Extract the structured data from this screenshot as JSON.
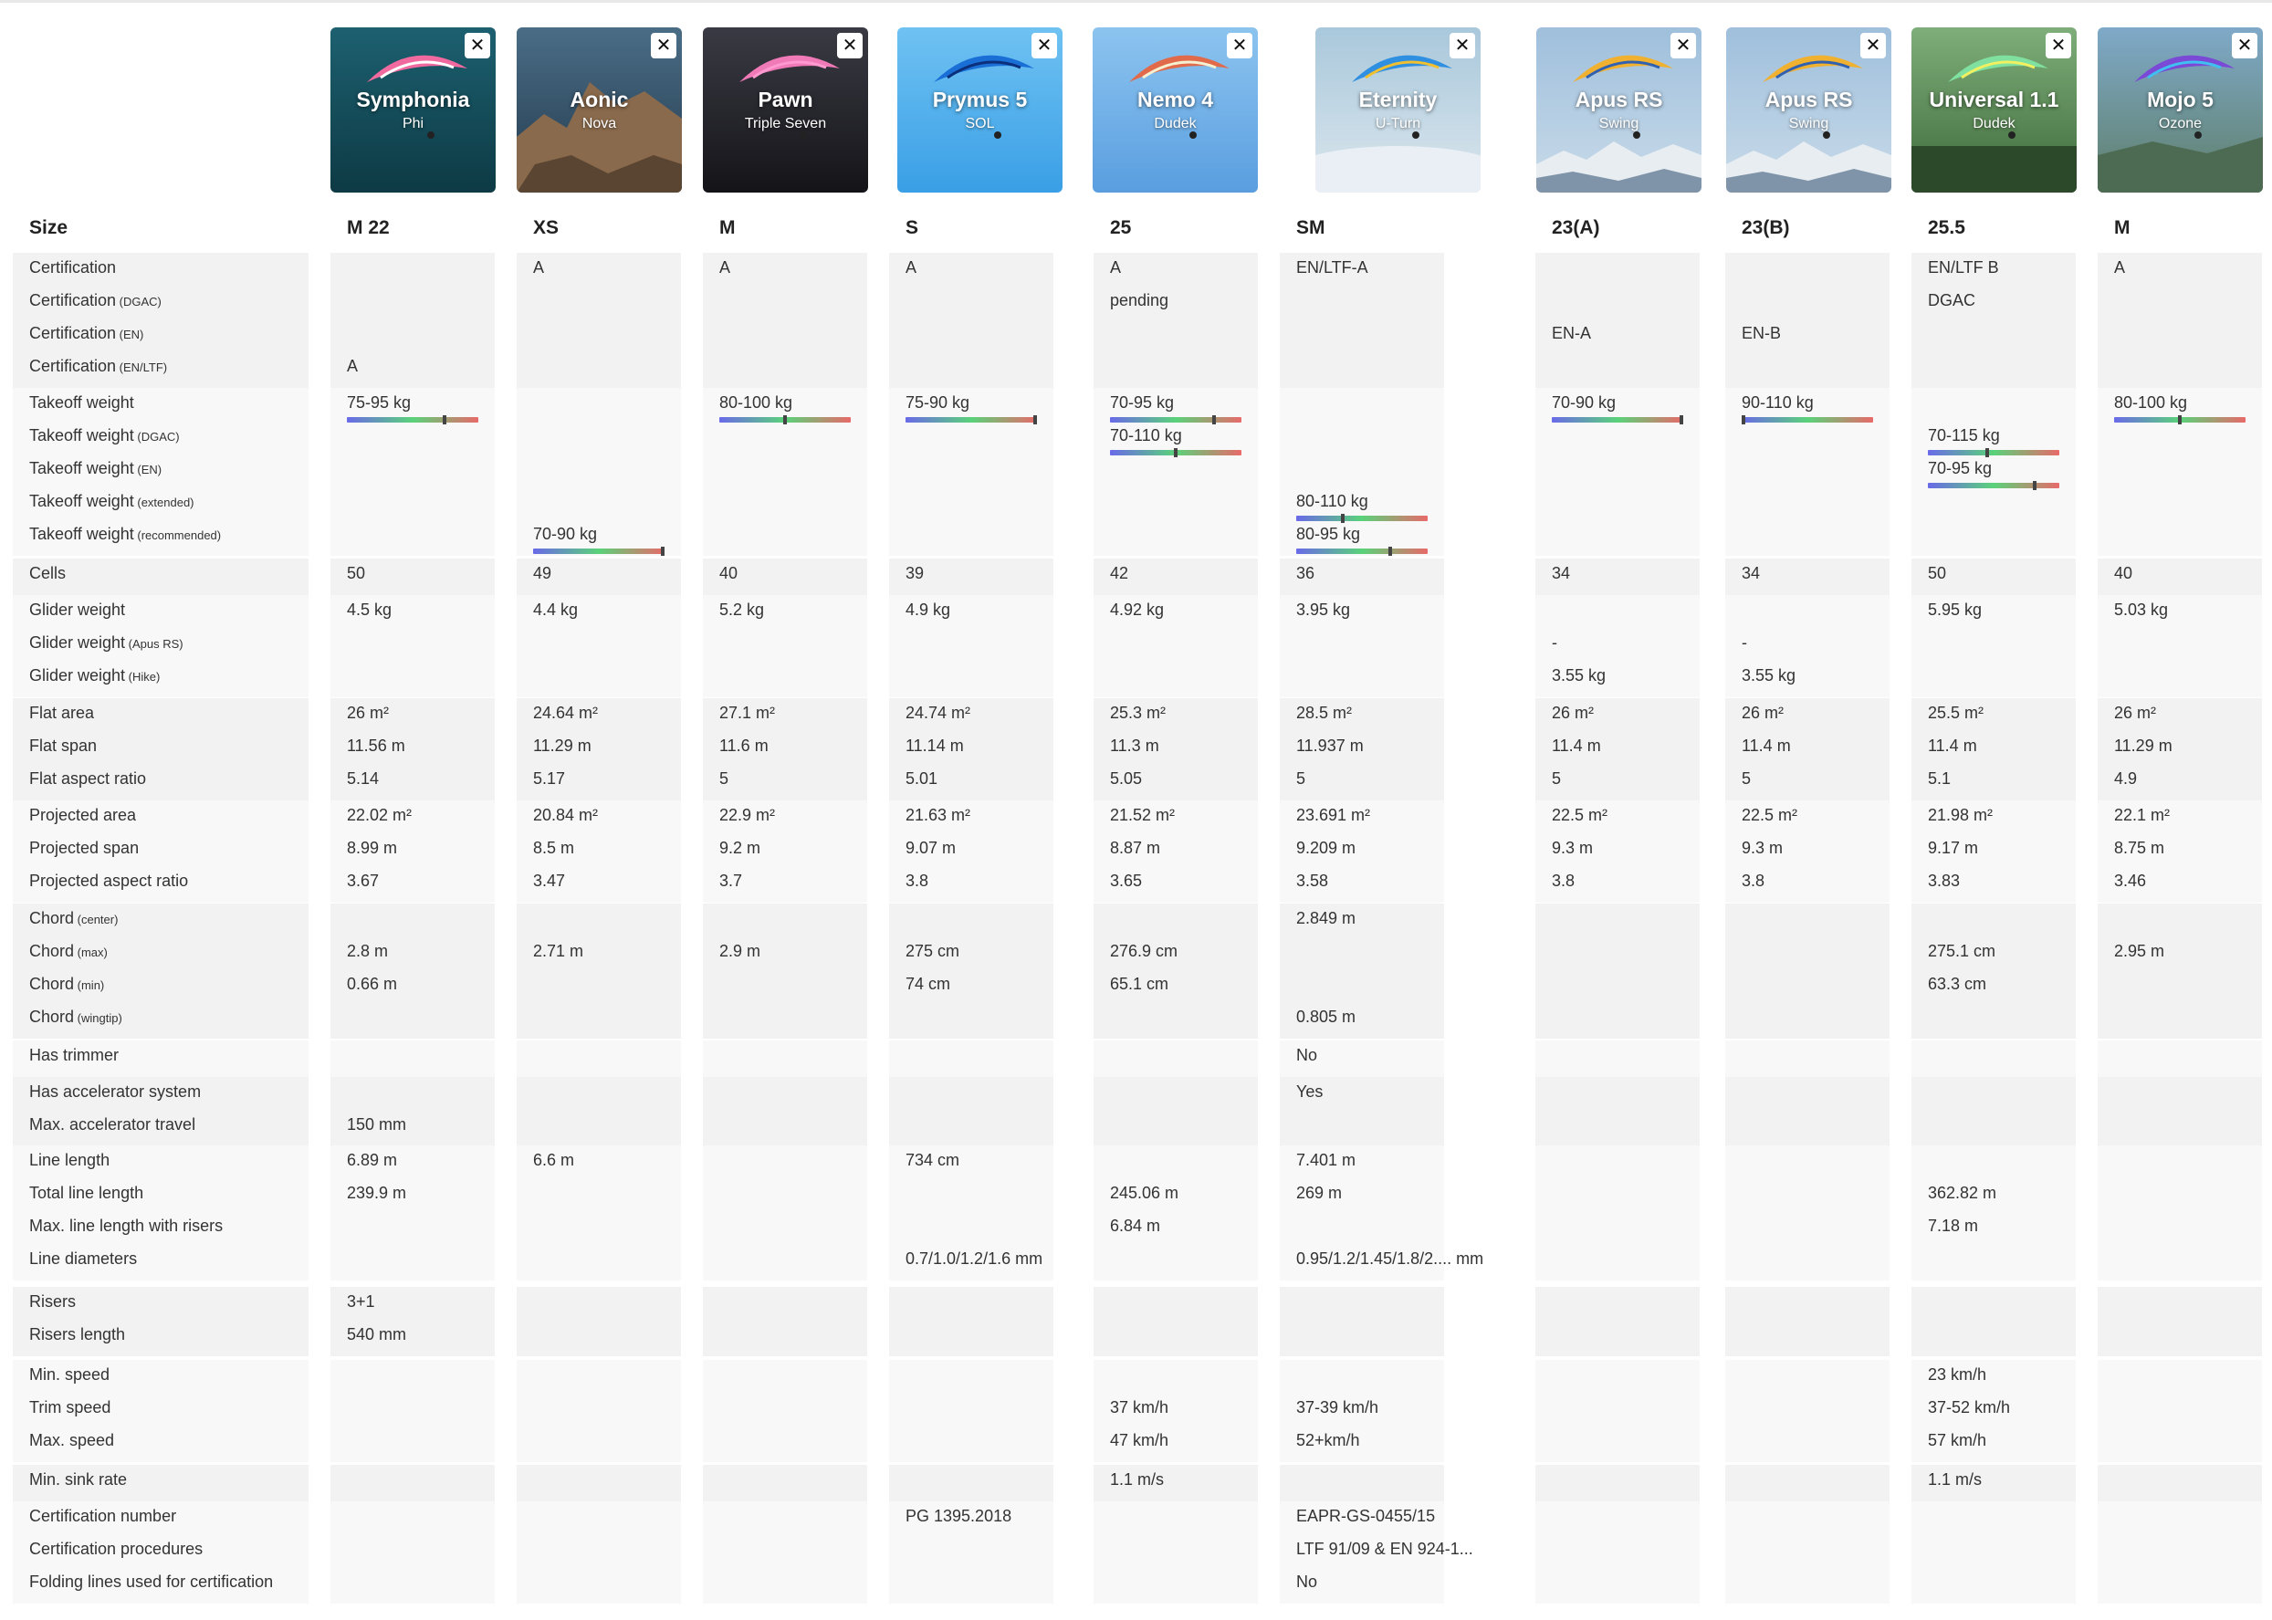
{
  "size_label": "Size",
  "gliders": [
    {
      "name": "Symphonia",
      "brand": "Phi",
      "size": "M 22",
      "photo": "pink-glider-sky"
    },
    {
      "name": "Aonic",
      "brand": "Nova",
      "size": "XS",
      "photo": "rocky-cliff"
    },
    {
      "name": "Pawn",
      "brand": "Triple Seven",
      "size": "M",
      "photo": "pink-glider-dark"
    },
    {
      "name": "Prymus 5",
      "brand": "SOL",
      "size": "S",
      "photo": "blue-glider-sky"
    },
    {
      "name": "Nemo 4",
      "brand": "Dudek",
      "size": "25",
      "photo": "multicolor-glider-sky"
    },
    {
      "name": "Eternity",
      "brand": "U-Turn",
      "size": "SM",
      "photo": "glider-clouds"
    },
    {
      "name": "Apus RS",
      "brand": "Swing",
      "size": "23(A)",
      "photo": "glider-mountains"
    },
    {
      "name": "Apus RS",
      "brand": "Swing",
      "size": "23(B)",
      "photo": "glider-mountains"
    },
    {
      "name": "Universal 1.1",
      "brand": "Dudek",
      "size": "25.5",
      "photo": "green-glider-forest"
    },
    {
      "name": "Mojo 5",
      "brand": "Ozone",
      "size": "M",
      "photo": "purple-glider-valley"
    }
  ],
  "groups": [
    {
      "labels": [
        [
          "Certification",
          ""
        ],
        [
          "Certification",
          "(DGAC)"
        ],
        [
          "Certification",
          "(EN)"
        ],
        [
          "Certification",
          "(EN/LTF)"
        ]
      ],
      "values": [
        [
          [
            "3",
            "A"
          ]
        ],
        [
          [
            "0",
            "A"
          ]
        ],
        [
          [
            "0",
            "A"
          ]
        ],
        [
          [
            "0",
            "A"
          ]
        ],
        [
          [
            "0",
            "A"
          ],
          [
            "1",
            "pending"
          ]
        ],
        [
          [
            "0",
            "EN/LTF-A"
          ]
        ],
        [
          [
            "2",
            "EN-A"
          ]
        ],
        [
          [
            "2",
            "EN-B"
          ]
        ],
        [
          [
            "0",
            "EN/LTF B"
          ],
          [
            "1",
            "DGAC"
          ]
        ],
        [
          [
            "0",
            "A"
          ]
        ]
      ]
    },
    {
      "labels": [
        [
          "Takeoff weight",
          ""
        ],
        [
          "Takeoff weight",
          "(DGAC)"
        ],
        [
          "Takeoff weight",
          "(EN)"
        ],
        [
          "Takeoff weight",
          "(extended)"
        ],
        [
          "Takeoff weight",
          "(recommended)"
        ]
      ],
      "values": [
        [
          [
            "0",
            "75-95 kg",
            0.75
          ]
        ],
        [
          [
            "4",
            "70-90 kg",
            1.0
          ]
        ],
        [
          [
            "0",
            "80-100 kg",
            0.5
          ]
        ],
        [
          [
            "0",
            "75-90 kg",
            1.0
          ]
        ],
        [
          [
            "0",
            "70-95 kg",
            0.8
          ],
          [
            "1",
            "70-110 kg",
            0.5
          ]
        ],
        [
          [
            "3",
            "80-110 kg",
            0.35
          ],
          [
            "4",
            "80-95 kg",
            0.72
          ]
        ],
        [
          [
            "0",
            "70-90 kg",
            1.0
          ]
        ],
        [
          [
            "0",
            "90-110 kg",
            0.0
          ]
        ],
        [
          [
            "1",
            "70-115 kg",
            0.45
          ],
          [
            "2",
            "70-95 kg",
            0.82
          ]
        ],
        [
          [
            "0",
            "80-100 kg",
            0.5
          ]
        ]
      ]
    },
    {
      "labels": [
        [
          "Cells",
          ""
        ]
      ],
      "values": [
        [
          [
            "0",
            "50"
          ]
        ],
        [
          [
            "0",
            "49"
          ]
        ],
        [
          [
            "0",
            "40"
          ]
        ],
        [
          [
            "0",
            "39"
          ]
        ],
        [
          [
            "0",
            "42"
          ]
        ],
        [
          [
            "0",
            "36"
          ]
        ],
        [
          [
            "0",
            "34"
          ]
        ],
        [
          [
            "0",
            "34"
          ]
        ],
        [
          [
            "0",
            "50"
          ]
        ],
        [
          [
            "0",
            "40"
          ]
        ]
      ]
    },
    {
      "labels": [
        [
          "Glider weight",
          ""
        ],
        [
          "Glider weight",
          "(Apus RS)"
        ],
        [
          "Glider weight",
          "(Hike)"
        ]
      ],
      "values": [
        [
          [
            "0",
            "4.5 kg"
          ]
        ],
        [
          [
            "0",
            "4.4 kg"
          ]
        ],
        [
          [
            "0",
            "5.2 kg"
          ]
        ],
        [
          [
            "0",
            "4.9 kg"
          ]
        ],
        [
          [
            "0",
            "4.92 kg"
          ]
        ],
        [
          [
            "0",
            "3.95 kg"
          ]
        ],
        [
          [
            "1",
            "-"
          ],
          [
            "2",
            "3.55 kg"
          ]
        ],
        [
          [
            "1",
            "-"
          ],
          [
            "2",
            "3.55 kg"
          ]
        ],
        [
          [
            "0",
            "5.95 kg"
          ]
        ],
        [
          [
            "0",
            "5.03 kg"
          ]
        ]
      ]
    },
    {
      "labels": [
        [
          "Flat area",
          ""
        ],
        [
          "Flat span",
          ""
        ],
        [
          "Flat aspect ratio",
          ""
        ]
      ],
      "values": [
        [
          [
            "0",
            "26 m²"
          ],
          [
            "1",
            "11.56 m"
          ],
          [
            "2",
            "5.14"
          ]
        ],
        [
          [
            "0",
            "24.64 m²"
          ],
          [
            "1",
            "11.29 m"
          ],
          [
            "2",
            "5.17"
          ]
        ],
        [
          [
            "0",
            "27.1 m²"
          ],
          [
            "1",
            "11.6 m"
          ],
          [
            "2",
            "5"
          ]
        ],
        [
          [
            "0",
            "24.74 m²"
          ],
          [
            "1",
            "11.14 m"
          ],
          [
            "2",
            "5.01"
          ]
        ],
        [
          [
            "0",
            "25.3 m²"
          ],
          [
            "1",
            "11.3 m"
          ],
          [
            "2",
            "5.05"
          ]
        ],
        [
          [
            "0",
            "28.5 m²"
          ],
          [
            "1",
            "11.937 m"
          ],
          [
            "2",
            "5"
          ]
        ],
        [
          [
            "0",
            "26 m²"
          ],
          [
            "1",
            "11.4 m"
          ],
          [
            "2",
            "5"
          ]
        ],
        [
          [
            "0",
            "26 m²"
          ],
          [
            "1",
            "11.4 m"
          ],
          [
            "2",
            "5"
          ]
        ],
        [
          [
            "0",
            "25.5 m²"
          ],
          [
            "1",
            "11.4 m"
          ],
          [
            "2",
            "5.1"
          ]
        ],
        [
          [
            "0",
            "26 m²"
          ],
          [
            "1",
            "11.29 m"
          ],
          [
            "2",
            "4.9"
          ]
        ]
      ]
    },
    {
      "labels": [
        [
          "Projected area",
          ""
        ],
        [
          "Projected span",
          ""
        ],
        [
          "Projected aspect ratio",
          ""
        ]
      ],
      "values": [
        [
          [
            "0",
            "22.02 m²"
          ],
          [
            "1",
            "8.99 m"
          ],
          [
            "2",
            "3.67"
          ]
        ],
        [
          [
            "0",
            "20.84 m²"
          ],
          [
            "1",
            "8.5 m"
          ],
          [
            "2",
            "3.47"
          ]
        ],
        [
          [
            "0",
            "22.9 m²"
          ],
          [
            "1",
            "9.2 m"
          ],
          [
            "2",
            "3.7"
          ]
        ],
        [
          [
            "0",
            "21.63 m²"
          ],
          [
            "1",
            "9.07 m"
          ],
          [
            "2",
            "3.8"
          ]
        ],
        [
          [
            "0",
            "21.52 m²"
          ],
          [
            "1",
            "8.87 m"
          ],
          [
            "2",
            "3.65"
          ]
        ],
        [
          [
            "0",
            "23.691 m²"
          ],
          [
            "1",
            "9.209 m"
          ],
          [
            "2",
            "3.58"
          ]
        ],
        [
          [
            "0",
            "22.5 m²"
          ],
          [
            "1",
            "9.3 m"
          ],
          [
            "2",
            "3.8"
          ]
        ],
        [
          [
            "0",
            "22.5 m²"
          ],
          [
            "1",
            "9.3 m"
          ],
          [
            "2",
            "3.8"
          ]
        ],
        [
          [
            "0",
            "21.98 m²"
          ],
          [
            "1",
            "9.17 m"
          ],
          [
            "2",
            "3.83"
          ]
        ],
        [
          [
            "0",
            "22.1 m²"
          ],
          [
            "1",
            "8.75 m"
          ],
          [
            "2",
            "3.46"
          ]
        ]
      ]
    },
    {
      "labels": [
        [
          "Chord",
          "(center)"
        ],
        [
          "Chord",
          "(max)"
        ],
        [
          "Chord",
          "(min)"
        ],
        [
          "Chord",
          "(wingtip)"
        ]
      ],
      "values": [
        [
          [
            "1",
            "2.8 m"
          ],
          [
            "2",
            "0.66 m"
          ]
        ],
        [
          [
            "1",
            "2.71 m"
          ]
        ],
        [
          [
            "1",
            "2.9 m"
          ]
        ],
        [
          [
            "1",
            "275 cm"
          ],
          [
            "2",
            "74 cm"
          ]
        ],
        [
          [
            "1",
            "276.9 cm"
          ],
          [
            "2",
            "65.1 cm"
          ]
        ],
        [
          [
            "0",
            "2.849 m"
          ],
          [
            "3",
            "0.805 m"
          ]
        ],
        [],
        [],
        [
          [
            "1",
            "275.1 cm"
          ],
          [
            "2",
            "63.3 cm"
          ]
        ],
        [
          [
            "1",
            "2.95 m"
          ]
        ]
      ]
    },
    {
      "labels": [
        [
          "Has trimmer",
          ""
        ]
      ],
      "values": [
        [],
        [],
        [],
        [],
        [],
        [
          [
            "0",
            "No"
          ]
        ],
        [],
        [],
        [],
        []
      ]
    },
    {
      "labels": [
        [
          "Has accelerator system",
          ""
        ],
        [
          "Max. accelerator travel",
          ""
        ]
      ],
      "values": [
        [
          [
            "1",
            "150 mm"
          ]
        ],
        [],
        [],
        [],
        [],
        [
          [
            "0",
            "Yes"
          ]
        ],
        [],
        [],
        [],
        []
      ]
    },
    {
      "labels": [
        [
          "Line length",
          ""
        ],
        [
          "Total line length",
          ""
        ],
        [
          "Max. line length with risers",
          ""
        ],
        [
          "Line diameters",
          ""
        ]
      ],
      "values": [
        [
          [
            "0",
            "6.89 m"
          ],
          [
            "1",
            "239.9 m"
          ]
        ],
        [
          [
            "0",
            "6.6 m"
          ]
        ],
        [],
        [
          [
            "0",
            "734 cm"
          ],
          [
            "3",
            "0.7/1.0/1.2/1.6 mm"
          ]
        ],
        [
          [
            "1",
            "245.06 m"
          ],
          [
            "2",
            "6.84 m"
          ]
        ],
        [
          [
            "0",
            "7.401 m"
          ],
          [
            "1",
            "269 m"
          ],
          [
            "3",
            "0.95/1.2/1.45/1.8/2.... mm"
          ]
        ],
        [],
        [],
        [
          [
            "1",
            "362.82 m"
          ],
          [
            "2",
            "7.18 m"
          ]
        ],
        []
      ]
    },
    {
      "labels": [
        [
          "Risers",
          ""
        ],
        [
          "Risers length",
          ""
        ]
      ],
      "values": [
        [
          [
            "0",
            "3+1"
          ],
          [
            "1",
            "540 mm"
          ]
        ],
        [],
        [],
        [],
        [],
        [],
        [],
        [],
        [],
        []
      ]
    },
    {
      "labels": [
        [
          "Min. speed",
          ""
        ],
        [
          "Trim speed",
          ""
        ],
        [
          "Max. speed",
          ""
        ]
      ],
      "values": [
        [],
        [],
        [],
        [],
        [
          [
            "1",
            "37 km/h"
          ],
          [
            "2",
            "47 km/h"
          ]
        ],
        [
          [
            "1",
            "37-39 km/h"
          ],
          [
            "2",
            "52+km/h"
          ]
        ],
        [],
        [],
        [
          [
            "0",
            "23 km/h"
          ],
          [
            "1",
            "37-52 km/h"
          ],
          [
            "2",
            "57 km/h"
          ]
        ],
        []
      ]
    },
    {
      "labels": [
        [
          "Min. sink rate",
          ""
        ]
      ],
      "values": [
        [],
        [],
        [],
        [],
        [
          [
            "0",
            "1.1 m/s"
          ]
        ],
        [],
        [],
        [],
        [
          [
            "0",
            "1.1 m/s"
          ]
        ],
        []
      ]
    },
    {
      "labels": [
        [
          "Certification number",
          ""
        ],
        [
          "Certification procedures",
          ""
        ],
        [
          "Folding lines used for certification",
          ""
        ]
      ],
      "values": [
        [],
        [],
        [],
        [
          [
            "0",
            "PG 1395.2018"
          ]
        ],
        [],
        [
          [
            "0",
            "EAPR-GS-0455/15"
          ],
          [
            "1",
            "LTF 91/09 & EN 924-1..."
          ],
          [
            "2",
            "No"
          ]
        ],
        [],
        [],
        [],
        []
      ]
    }
  ]
}
